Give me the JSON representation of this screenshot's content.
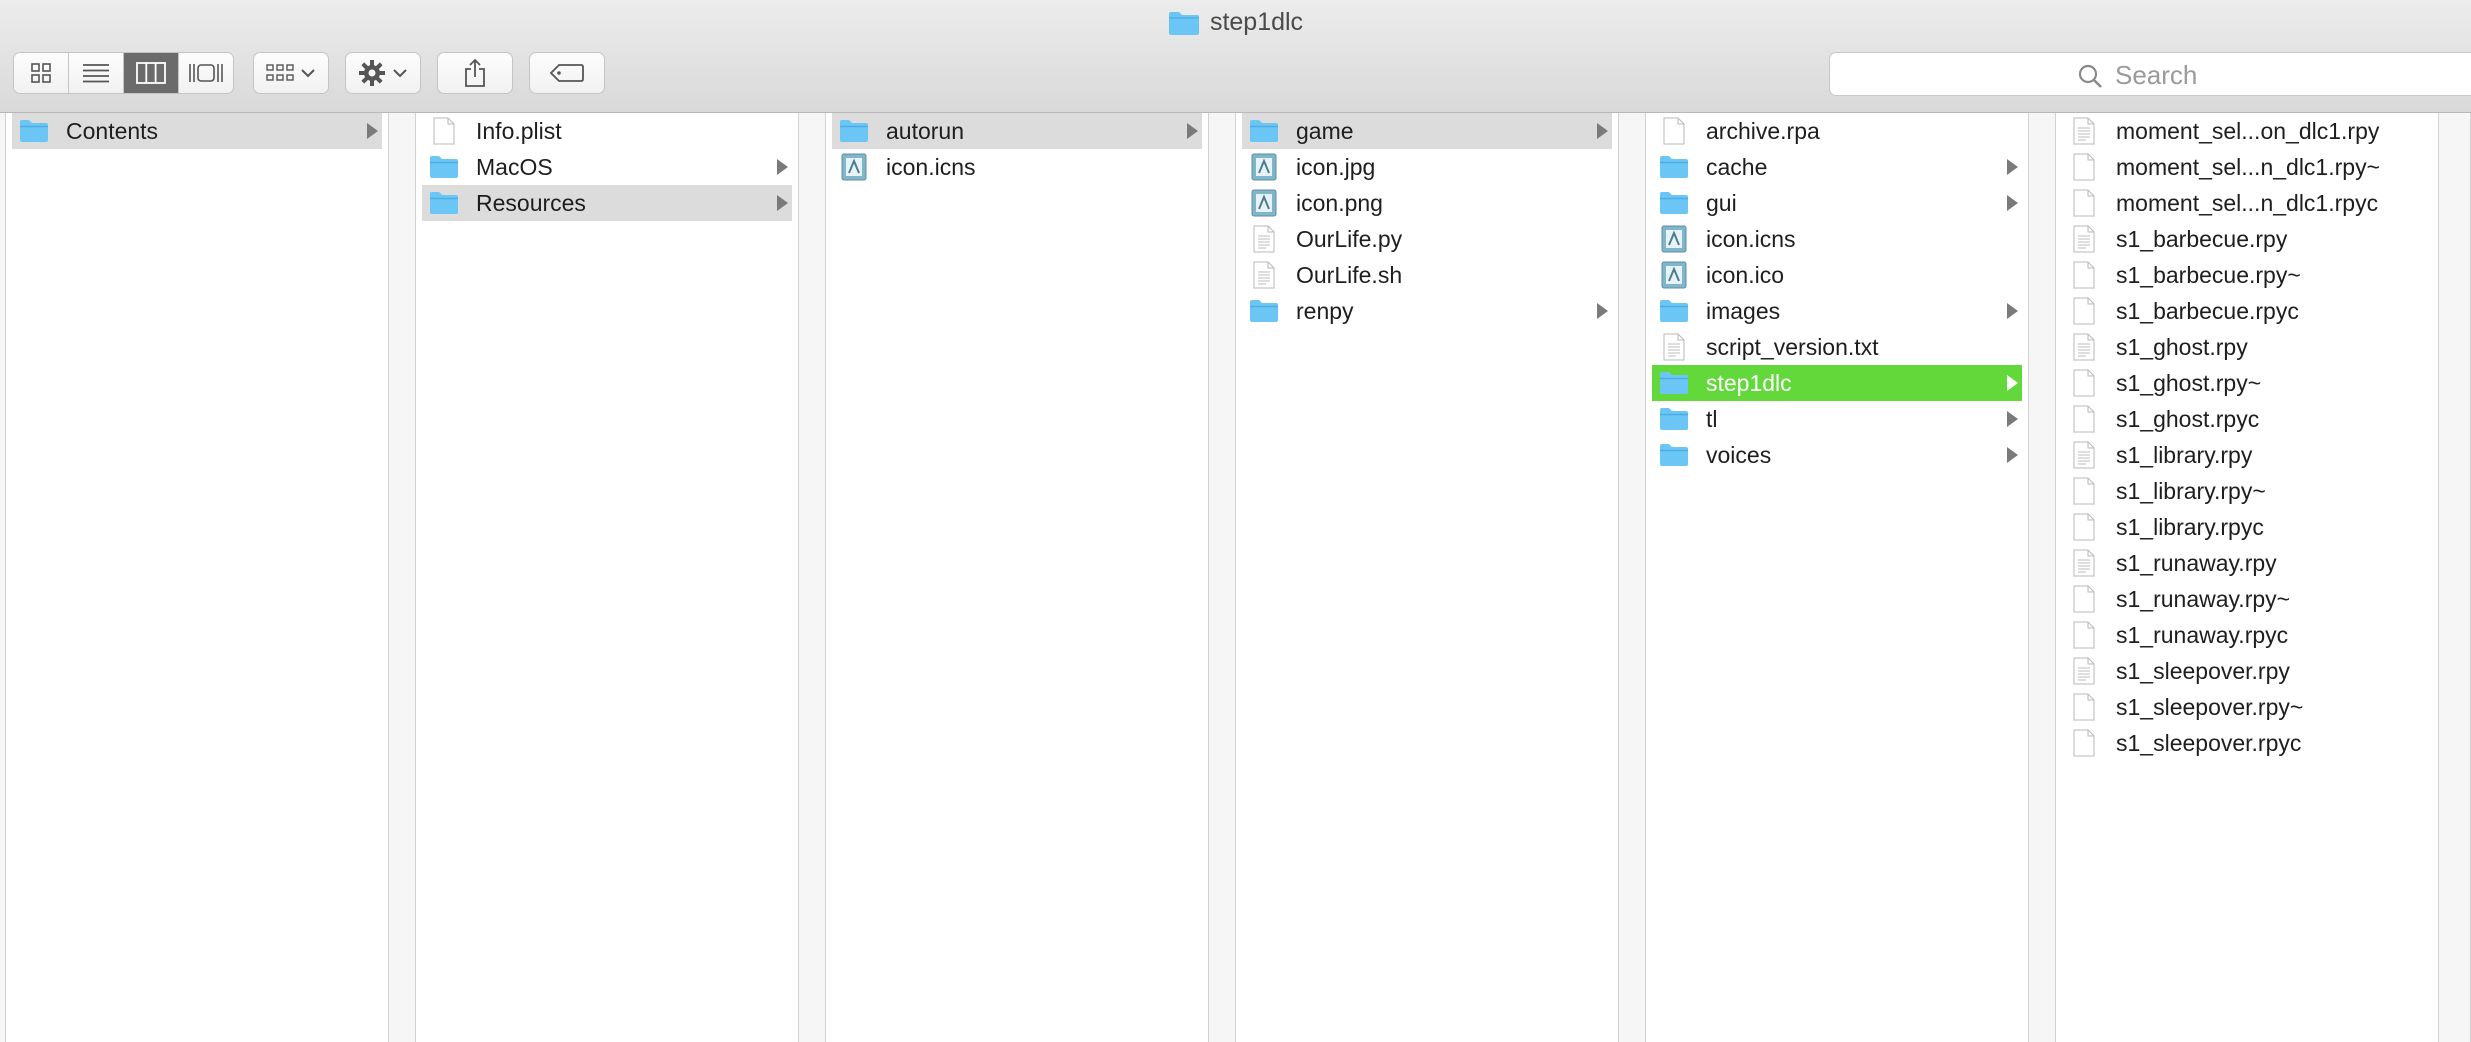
{
  "window": {
    "title": "step1dlc"
  },
  "toolbar": {
    "view_buttons": [
      "icon-view-icon",
      "list-view-icon",
      "column-view-icon",
      "gallery-view-icon"
    ],
    "active_view": "column-view-icon"
  },
  "search": {
    "placeholder": "Search"
  },
  "colors": {
    "selection_active": "#63d83b",
    "selection_inactive": "#dcdcdc",
    "folder": "#6cc6f5"
  },
  "columns": [
    {
      "items": [
        {
          "label": "Contents",
          "type": "folder",
          "arrow": true,
          "selected": "grey"
        }
      ]
    },
    {
      "items": [
        {
          "label": "Info.plist",
          "type": "file",
          "arrow": false
        },
        {
          "label": "MacOS",
          "type": "folder",
          "arrow": true
        },
        {
          "label": "Resources",
          "type": "folder",
          "arrow": true,
          "selected": "grey"
        }
      ]
    },
    {
      "items": [
        {
          "label": "autorun",
          "type": "folder",
          "arrow": true,
          "selected": "grey"
        },
        {
          "label": "icon.icns",
          "type": "icon-image",
          "arrow": false
        }
      ]
    },
    {
      "items": [
        {
          "label": "game",
          "type": "folder",
          "arrow": true,
          "selected": "grey"
        },
        {
          "label": "icon.jpg",
          "type": "image",
          "arrow": false
        },
        {
          "label": "icon.png",
          "type": "image",
          "arrow": false
        },
        {
          "label": "OurLife.py",
          "type": "text",
          "arrow": false
        },
        {
          "label": "OurLife.sh",
          "type": "text",
          "arrow": false
        },
        {
          "label": "renpy",
          "type": "folder",
          "arrow": true
        }
      ]
    },
    {
      "items": [
        {
          "label": "archive.rpa",
          "type": "file",
          "arrow": false
        },
        {
          "label": "cache",
          "type": "folder",
          "arrow": true
        },
        {
          "label": "gui",
          "type": "folder",
          "arrow": true
        },
        {
          "label": "icon.icns",
          "type": "icon-image",
          "arrow": false
        },
        {
          "label": "icon.ico",
          "type": "image",
          "arrow": false
        },
        {
          "label": "images",
          "type": "folder",
          "arrow": true
        },
        {
          "label": "script_version.txt",
          "type": "text",
          "arrow": false
        },
        {
          "label": "step1dlc",
          "type": "folder",
          "arrow": true,
          "selected": "green"
        },
        {
          "label": "tl",
          "type": "folder",
          "arrow": true
        },
        {
          "label": "voices",
          "type": "folder",
          "arrow": true
        }
      ]
    },
    {
      "items": [
        {
          "label": "moment_sel...on_dlc1.rpy",
          "type": "text",
          "arrow": false
        },
        {
          "label": "moment_sel...n_dlc1.rpy~",
          "type": "file",
          "arrow": false
        },
        {
          "label": "moment_sel...n_dlc1.rpyc",
          "type": "file",
          "arrow": false
        },
        {
          "label": "s1_barbecue.rpy",
          "type": "text",
          "arrow": false
        },
        {
          "label": "s1_barbecue.rpy~",
          "type": "file",
          "arrow": false
        },
        {
          "label": "s1_barbecue.rpyc",
          "type": "file",
          "arrow": false
        },
        {
          "label": "s1_ghost.rpy",
          "type": "text",
          "arrow": false
        },
        {
          "label": "s1_ghost.rpy~",
          "type": "file",
          "arrow": false
        },
        {
          "label": "s1_ghost.rpyc",
          "type": "file",
          "arrow": false
        },
        {
          "label": "s1_library.rpy",
          "type": "text",
          "arrow": false
        },
        {
          "label": "s1_library.rpy~",
          "type": "file",
          "arrow": false
        },
        {
          "label": "s1_library.rpyc",
          "type": "file",
          "arrow": false
        },
        {
          "label": "s1_runaway.rpy",
          "type": "text",
          "arrow": false
        },
        {
          "label": "s1_runaway.rpy~",
          "type": "file",
          "arrow": false
        },
        {
          "label": "s1_runaway.rpyc",
          "type": "file",
          "arrow": false
        },
        {
          "label": "s1_sleepover.rpy",
          "type": "text",
          "arrow": false
        },
        {
          "label": "s1_sleepover.rpy~",
          "type": "file",
          "arrow": false
        },
        {
          "label": "s1_sleepover.rpyc",
          "type": "file",
          "arrow": false
        }
      ]
    }
  ]
}
